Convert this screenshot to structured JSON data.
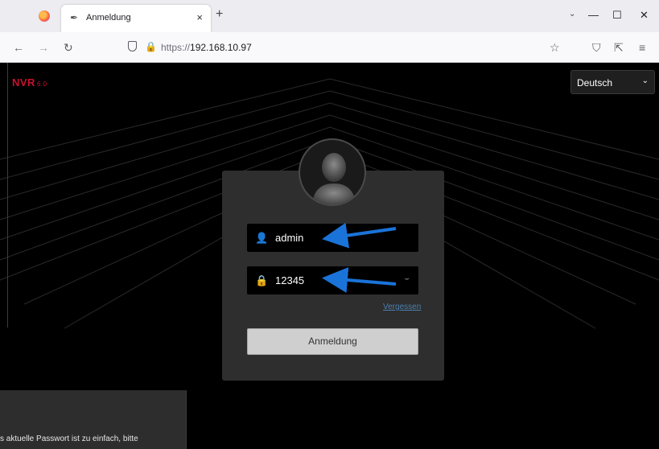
{
  "browser": {
    "tab_title": "Anmeldung",
    "tab_close": "×",
    "new_tab": "+",
    "tab_list": "⌄",
    "minimize": "—",
    "maximize": "☐",
    "close": "✕",
    "url_protocol": "https://",
    "url_host": "192.168.10.97",
    "icons": [
      "firefox-logo",
      "back-arrow",
      "forward-arrow",
      "reload",
      "shield",
      "lock",
      "star",
      "pocket",
      "extensions",
      "menu"
    ]
  },
  "app": {
    "brand": "NVR",
    "brand_version": "6.0",
    "language": {
      "selected": "Deutsch",
      "arrow": "⌄"
    },
    "login": {
      "username_value": "admin",
      "password_value": "12345",
      "forgot_link": "Vergessen",
      "submit_label": "Anmeldung"
    },
    "toast": {
      "text": "s aktuelle Passwort ist zu einfach, bitte"
    },
    "colors": {
      "brand": "#c8102e",
      "panel": "#2e2e2e",
      "arrow": "#1a73d9",
      "link": "#4c7fb0"
    }
  }
}
